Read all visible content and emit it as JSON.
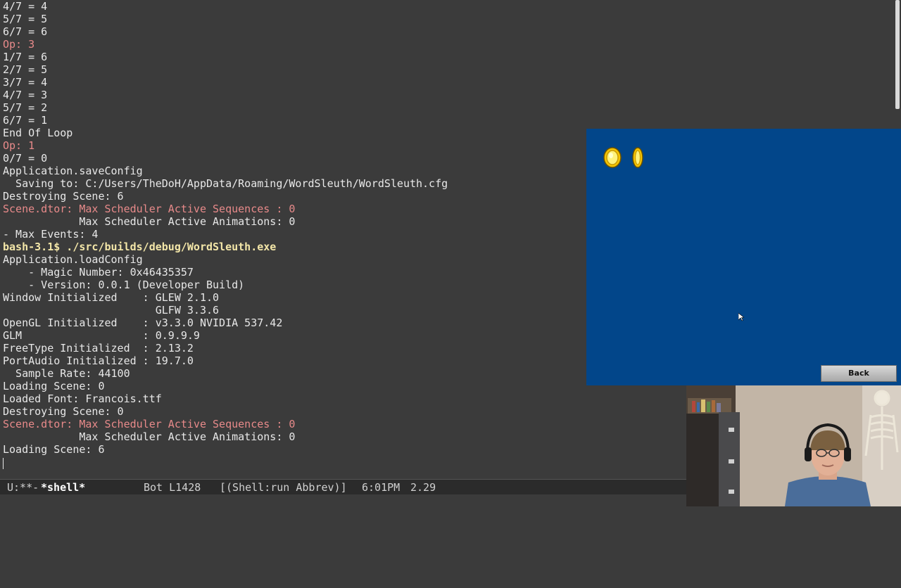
{
  "terminal": {
    "lines": [
      {
        "text": "4/7 = 4",
        "style": "normal"
      },
      {
        "text": "5/7 = 5",
        "style": "normal"
      },
      {
        "text": "6/7 = 6",
        "style": "normal"
      },
      {
        "text": "Op: 3",
        "style": "op"
      },
      {
        "text": "1/7 = 6",
        "style": "normal"
      },
      {
        "text": "2/7 = 5",
        "style": "normal"
      },
      {
        "text": "3/7 = 4",
        "style": "normal"
      },
      {
        "text": "4/7 = 3",
        "style": "normal"
      },
      {
        "text": "5/7 = 2",
        "style": "normal"
      },
      {
        "text": "6/7 = 1",
        "style": "normal"
      },
      {
        "text": "End Of Loop",
        "style": "normal"
      },
      {
        "text": "Op: 1",
        "style": "op"
      },
      {
        "text": "0/7 = 0",
        "style": "normal"
      },
      {
        "text": "Application.saveConfig",
        "style": "normal"
      },
      {
        "text": "  Saving to: C:/Users/TheDoH/AppData/Roaming/WordSleuth/WordSleuth.cfg",
        "style": "normal"
      },
      {
        "text": "Destroying Scene: 6",
        "style": "normal"
      },
      {
        "text": "Scene.dtor: Max Scheduler Active Sequences : 0",
        "style": "op"
      },
      {
        "text": "            Max Scheduler Active Animations: 0",
        "style": "normal"
      },
      {
        "text": "- Max Events: 4",
        "style": "normal"
      },
      {
        "text": "bash-3.1$ ./src/builds/debug/WordSleuth.exe",
        "style": "prompt"
      },
      {
        "text": "Application.loadConfig",
        "style": "normal"
      },
      {
        "text": "    - Magic Number: 0x46435357",
        "style": "normal"
      },
      {
        "text": "    - Version: 0.0.1 (Developer Build)",
        "style": "normal"
      },
      {
        "text": "Window Initialized    : GLEW 2.1.0",
        "style": "normal"
      },
      {
        "text": "                        GLFW 3.3.6",
        "style": "normal"
      },
      {
        "text": "OpenGL Initialized    : v3.3.0 NVIDIA 537.42",
        "style": "normal"
      },
      {
        "text": "GLM                   : 0.9.9.9",
        "style": "normal"
      },
      {
        "text": "FreeType Initialized  : 2.13.2",
        "style": "normal"
      },
      {
        "text": "PortAudio Initialized : 19.7.0",
        "style": "normal"
      },
      {
        "text": "  Sample Rate: 44100",
        "style": "normal"
      },
      {
        "text": "Loading Scene: 0",
        "style": "normal"
      },
      {
        "text": "Loaded Font: Francois.ttf",
        "style": "normal"
      },
      {
        "text": "Destroying Scene: 0",
        "style": "normal"
      },
      {
        "text": "Scene.dtor: Max Scheduler Active Sequences : 0",
        "style": "op"
      },
      {
        "text": "            Max Scheduler Active Animations: 0",
        "style": "normal"
      },
      {
        "text": "Loading Scene: 6",
        "style": "normal"
      }
    ]
  },
  "mode_line": {
    "status": "U:**-",
    "buffer": "*shell*",
    "position": "Bot L1428",
    "modes": "[(Shell:run Abbrev)]",
    "time": "6:01PM",
    "load": "2.29"
  },
  "game_window": {
    "background": "#02468a",
    "coin_icons": [
      "coin-front-icon",
      "coin-edge-icon"
    ],
    "back_button_label": "Back"
  },
  "colors": {
    "terminal_bg": "#3b3b3b",
    "terminal_fg": "#e8e8e8",
    "op_line": "#e88a8a",
    "prompt": "#f3e6a8"
  }
}
